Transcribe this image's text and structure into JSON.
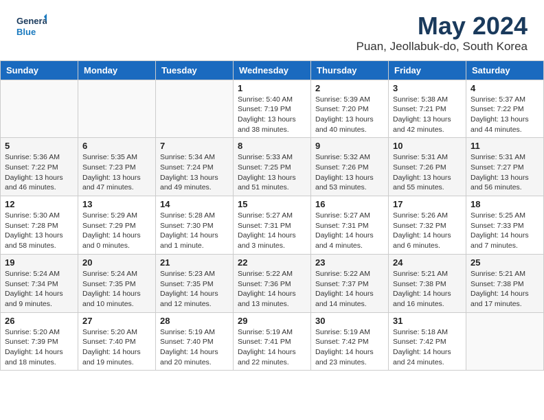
{
  "header": {
    "logo_line1": "General",
    "logo_line2": "Blue",
    "title": "May 2024",
    "subtitle": "Puan, Jeollabuk-do, South Korea"
  },
  "days_of_week": [
    "Sunday",
    "Monday",
    "Tuesday",
    "Wednesday",
    "Thursday",
    "Friday",
    "Saturday"
  ],
  "weeks": [
    [
      {
        "day": "",
        "info": ""
      },
      {
        "day": "",
        "info": ""
      },
      {
        "day": "",
        "info": ""
      },
      {
        "day": "1",
        "info": "Sunrise: 5:40 AM\nSunset: 7:19 PM\nDaylight: 13 hours\nand 38 minutes."
      },
      {
        "day": "2",
        "info": "Sunrise: 5:39 AM\nSunset: 7:20 PM\nDaylight: 13 hours\nand 40 minutes."
      },
      {
        "day": "3",
        "info": "Sunrise: 5:38 AM\nSunset: 7:21 PM\nDaylight: 13 hours\nand 42 minutes."
      },
      {
        "day": "4",
        "info": "Sunrise: 5:37 AM\nSunset: 7:22 PM\nDaylight: 13 hours\nand 44 minutes."
      }
    ],
    [
      {
        "day": "5",
        "info": "Sunrise: 5:36 AM\nSunset: 7:22 PM\nDaylight: 13 hours\nand 46 minutes."
      },
      {
        "day": "6",
        "info": "Sunrise: 5:35 AM\nSunset: 7:23 PM\nDaylight: 13 hours\nand 47 minutes."
      },
      {
        "day": "7",
        "info": "Sunrise: 5:34 AM\nSunset: 7:24 PM\nDaylight: 13 hours\nand 49 minutes."
      },
      {
        "day": "8",
        "info": "Sunrise: 5:33 AM\nSunset: 7:25 PM\nDaylight: 13 hours\nand 51 minutes."
      },
      {
        "day": "9",
        "info": "Sunrise: 5:32 AM\nSunset: 7:26 PM\nDaylight: 13 hours\nand 53 minutes."
      },
      {
        "day": "10",
        "info": "Sunrise: 5:31 AM\nSunset: 7:26 PM\nDaylight: 13 hours\nand 55 minutes."
      },
      {
        "day": "11",
        "info": "Sunrise: 5:31 AM\nSunset: 7:27 PM\nDaylight: 13 hours\nand 56 minutes."
      }
    ],
    [
      {
        "day": "12",
        "info": "Sunrise: 5:30 AM\nSunset: 7:28 PM\nDaylight: 13 hours\nand 58 minutes."
      },
      {
        "day": "13",
        "info": "Sunrise: 5:29 AM\nSunset: 7:29 PM\nDaylight: 14 hours\nand 0 minutes."
      },
      {
        "day": "14",
        "info": "Sunrise: 5:28 AM\nSunset: 7:30 PM\nDaylight: 14 hours\nand 1 minute."
      },
      {
        "day": "15",
        "info": "Sunrise: 5:27 AM\nSunset: 7:31 PM\nDaylight: 14 hours\nand 3 minutes."
      },
      {
        "day": "16",
        "info": "Sunrise: 5:27 AM\nSunset: 7:31 PM\nDaylight: 14 hours\nand 4 minutes."
      },
      {
        "day": "17",
        "info": "Sunrise: 5:26 AM\nSunset: 7:32 PM\nDaylight: 14 hours\nand 6 minutes."
      },
      {
        "day": "18",
        "info": "Sunrise: 5:25 AM\nSunset: 7:33 PM\nDaylight: 14 hours\nand 7 minutes."
      }
    ],
    [
      {
        "day": "19",
        "info": "Sunrise: 5:24 AM\nSunset: 7:34 PM\nDaylight: 14 hours\nand 9 minutes."
      },
      {
        "day": "20",
        "info": "Sunrise: 5:24 AM\nSunset: 7:35 PM\nDaylight: 14 hours\nand 10 minutes."
      },
      {
        "day": "21",
        "info": "Sunrise: 5:23 AM\nSunset: 7:35 PM\nDaylight: 14 hours\nand 12 minutes."
      },
      {
        "day": "22",
        "info": "Sunrise: 5:22 AM\nSunset: 7:36 PM\nDaylight: 14 hours\nand 13 minutes."
      },
      {
        "day": "23",
        "info": "Sunrise: 5:22 AM\nSunset: 7:37 PM\nDaylight: 14 hours\nand 14 minutes."
      },
      {
        "day": "24",
        "info": "Sunrise: 5:21 AM\nSunset: 7:38 PM\nDaylight: 14 hours\nand 16 minutes."
      },
      {
        "day": "25",
        "info": "Sunrise: 5:21 AM\nSunset: 7:38 PM\nDaylight: 14 hours\nand 17 minutes."
      }
    ],
    [
      {
        "day": "26",
        "info": "Sunrise: 5:20 AM\nSunset: 7:39 PM\nDaylight: 14 hours\nand 18 minutes."
      },
      {
        "day": "27",
        "info": "Sunrise: 5:20 AM\nSunset: 7:40 PM\nDaylight: 14 hours\nand 19 minutes."
      },
      {
        "day": "28",
        "info": "Sunrise: 5:19 AM\nSunset: 7:40 PM\nDaylight: 14 hours\nand 20 minutes."
      },
      {
        "day": "29",
        "info": "Sunrise: 5:19 AM\nSunset: 7:41 PM\nDaylight: 14 hours\nand 22 minutes."
      },
      {
        "day": "30",
        "info": "Sunrise: 5:19 AM\nSunset: 7:42 PM\nDaylight: 14 hours\nand 23 minutes."
      },
      {
        "day": "31",
        "info": "Sunrise: 5:18 AM\nSunset: 7:42 PM\nDaylight: 14 hours\nand 24 minutes."
      },
      {
        "day": "",
        "info": ""
      }
    ]
  ]
}
